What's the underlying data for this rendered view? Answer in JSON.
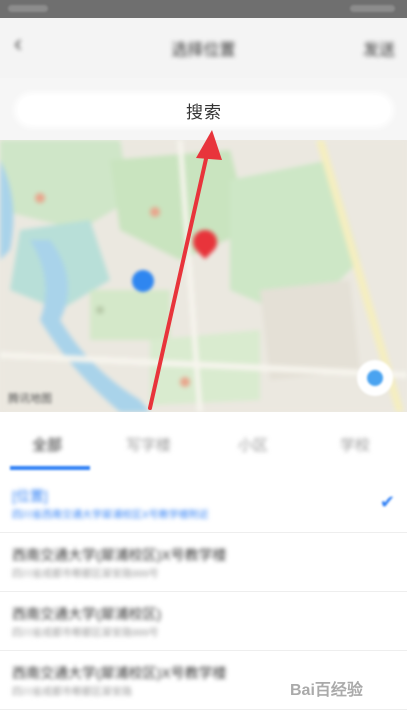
{
  "header": {
    "title": "选择位置",
    "send_label": "发送"
  },
  "search": {
    "label": "搜索"
  },
  "map": {
    "provider_label": "腾讯地图"
  },
  "tabs": [
    {
      "label": "全部"
    },
    {
      "label": "写字楼"
    },
    {
      "label": "小区"
    },
    {
      "label": "学校"
    }
  ],
  "places": [
    {
      "name": "[位置]",
      "address": "四川省西南交通大学犀浦校区X号教学楼附近",
      "selected": true
    },
    {
      "name": "西南交通大学(犀浦校区)X号教学楼",
      "address": "四川省成都市郫都区犀安路999号"
    },
    {
      "name": "西南交通大学(犀浦校区)",
      "address": "四川省成都市郫都区犀安路999号"
    },
    {
      "name": "西南交通大学(犀浦校区)X号教学楼",
      "address": "四川省成都市郫都区犀安路"
    }
  ],
  "watermark": {
    "text": "Bai百经验"
  },
  "colors": {
    "accent": "#2e7ff5",
    "annotation_arrow": "#e8343b",
    "map_pin": "#e8343b"
  }
}
